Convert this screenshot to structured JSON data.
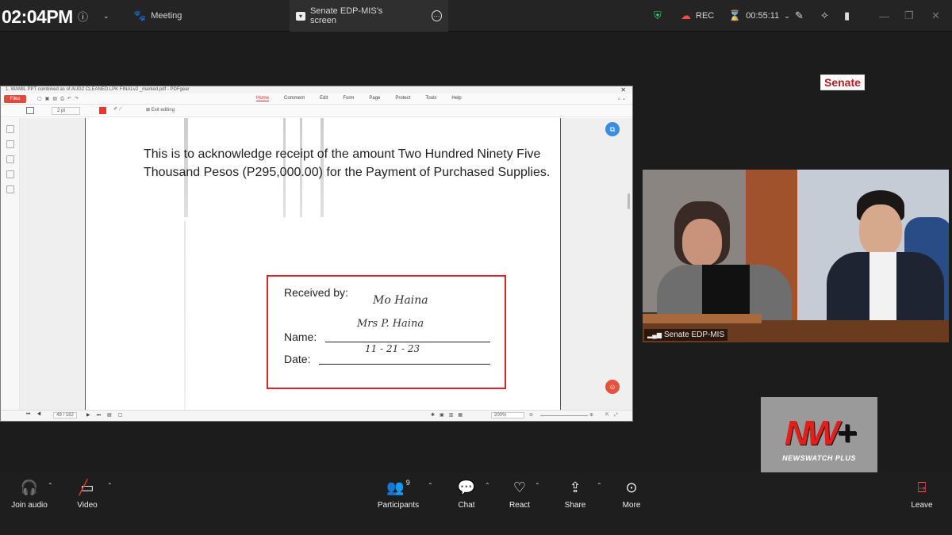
{
  "topbar": {
    "clock": "02:04PM",
    "tab_meeting": "Meeting",
    "tab_screen": "Senate EDP-MIS's screen",
    "rec": "REC",
    "timer": "00:55:11"
  },
  "pdf": {
    "title": "1. WAMIL PPT combined as of AUG2 CLEANED.LPK FINALv2 _marked.pdf - PDFgear",
    "files": "Files",
    "menu": [
      "Home",
      "Comment",
      "Edit",
      "Form",
      "Page",
      "Protect",
      "Tools",
      "Help"
    ],
    "pen_size": "2 pt",
    "exit_editing": "Exit editing",
    "ack_text": "This is to acknowledge receipt of the amount Two Hundred Ninety Five Thousand Pesos (P295,000.00) for the Payment of Purchased Supplies.",
    "received_by": "Received by:",
    "name_label": "Name:",
    "date_label": "Date:",
    "signature": "Mo Haina",
    "hand_name": "Mrs P. Haina",
    "hand_date": "11 - 21 - 23",
    "page_indicator": "49 / 182",
    "zoom": "200%"
  },
  "senate_tag": "Senate",
  "video": {
    "label": "Senate EDP-MIS"
  },
  "logo": {
    "mark_red": "NW",
    "mark_plus": "+",
    "text": "NEWSWATCH PLUS"
  },
  "bottombar": {
    "join_audio": "Join audio",
    "video": "Video",
    "participants": "Participants",
    "participants_count": "9",
    "chat": "Chat",
    "react": "React",
    "share": "Share",
    "more": "More",
    "leave": "Leave"
  },
  "colors": {
    "accent_red": "#d7262b",
    "rec_red": "#ff4a4a",
    "shield_green": "#2ecc71"
  }
}
